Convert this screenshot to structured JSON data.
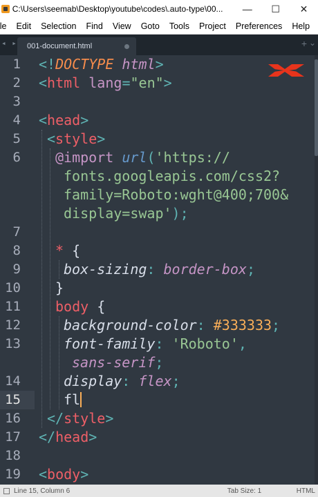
{
  "window": {
    "title": "C:\\Users\\seemab\\Desktop\\youtube\\codes\\.auto-type\\00...",
    "minimize_glyph": "—",
    "maximize_glyph": "☐",
    "close_glyph": "✕"
  },
  "menu": [
    "ile",
    "Edit",
    "Selection",
    "Find",
    "View",
    "Goto",
    "Tools",
    "Project",
    "Preferences",
    "Help"
  ],
  "tab": {
    "arrows": "◂ ▸",
    "label": "001-document.html",
    "plus": "+",
    "chevron": "⌄"
  },
  "editor": {
    "active_line": 15,
    "lines": [
      {
        "n": "1"
      },
      {
        "n": "2"
      },
      {
        "n": "3"
      },
      {
        "n": "4"
      },
      {
        "n": "5"
      },
      {
        "n": "6"
      },
      {
        "n": ""
      },
      {
        "n": ""
      },
      {
        "n": ""
      },
      {
        "n": "7"
      },
      {
        "n": "8"
      },
      {
        "n": "9"
      },
      {
        "n": "10"
      },
      {
        "n": "11"
      },
      {
        "n": "12"
      },
      {
        "n": "13"
      },
      {
        "n": ""
      },
      {
        "n": "14"
      },
      {
        "n": "15"
      },
      {
        "n": "16"
      },
      {
        "n": "17"
      },
      {
        "n": "18"
      },
      {
        "n": "19"
      }
    ]
  },
  "code": {
    "l1_a": "<!",
    "l1_b": "DOCTYPE",
    "l1_c": " html",
    "l1_d": ">",
    "l2_a": "<",
    "l2_b": "html",
    "l2_c": " lang",
    "l2_d": "=",
    "l2_e": "\"en\"",
    "l2_f": ">",
    "l4_a": "<",
    "l4_b": "head",
    "l4_c": ">",
    "l5_a": "<",
    "l5_b": "style",
    "l5_c": ">",
    "l6_a": "@import",
    "l6_b": " url",
    "l6_c": "(",
    "l6_d": "'https://",
    "l6_e": "fonts.googleapis.com/css2?",
    "l6_f": "family=Roboto:wght@400;700&",
    "l6_g": "display=swap'",
    "l6_h": ");",
    "l8_a": "*",
    "l8_b": " {",
    "l9_a": "box-sizing",
    "l9_b": ": ",
    "l9_c": "border-box",
    "l9_d": ";",
    "l10_a": "}",
    "l11_a": "body",
    "l11_b": " {",
    "l12_a": "background-color",
    "l12_b": ": ",
    "l12_c": "#333333",
    "l12_d": ";",
    "l13_a": "font-family",
    "l13_b": ": ",
    "l13_c": "'Roboto'",
    "l13_d": ",",
    "l13_e": "sans-serif",
    "l13_f": ";",
    "l14_a": "display",
    "l14_b": ": ",
    "l14_c": "flex",
    "l14_d": ";",
    "l15_a": "fl",
    "l16_a": "</",
    "l16_b": "style",
    "l16_c": ">",
    "l17_a": "</",
    "l17_b": "head",
    "l17_c": ">",
    "l19_a": "<",
    "l19_b": "body",
    "l19_c": ">"
  },
  "status": {
    "position": "Line 15, Column 6",
    "tab_size": "Tab Size: 1",
    "syntax": "HTML"
  },
  "colors": {
    "background": "#303841",
    "tag": "#ee5f67",
    "punctuation": "#5fb4b4",
    "string": "#99c794",
    "keyword": "#c695c6",
    "number": "#f9ae58",
    "logo": "#e8341c"
  }
}
